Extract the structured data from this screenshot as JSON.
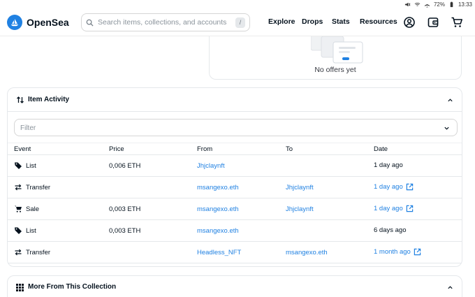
{
  "status_bar": {
    "battery": "72%",
    "time": "13:33"
  },
  "header": {
    "brand": "OpenSea",
    "search": {
      "placeholder": "Search items, collections, and accounts",
      "shortcut": "/"
    },
    "nav": [
      "Explore",
      "Drops",
      "Stats",
      "Resources"
    ],
    "icons": [
      "account-icon",
      "wallet-icon",
      "cart-icon"
    ]
  },
  "offers": {
    "empty_text": "No offers yet"
  },
  "activity": {
    "title": "Item Activity",
    "filter_placeholder": "Filter",
    "columns": [
      "Event",
      "Price",
      "From",
      "To",
      "Date"
    ],
    "rows": [
      {
        "event": "List",
        "icon": "tag-icon",
        "price": "0,006 ETH",
        "from": "Jhjclaynft",
        "to": "",
        "date": "1 day ago",
        "date_link": false
      },
      {
        "event": "Transfer",
        "icon": "transfer-icon",
        "price": "",
        "from": "msangexo.eth",
        "to": "Jhjclaynft",
        "date": "1 day ago",
        "date_link": true
      },
      {
        "event": "Sale",
        "icon": "cart-icon",
        "price": "0,003 ETH",
        "from": "msangexo.eth",
        "to": "Jhjclaynft",
        "date": "1 day ago",
        "date_link": true
      },
      {
        "event": "List",
        "icon": "tag-icon",
        "price": "0,003 ETH",
        "from": "msangexo.eth",
        "to": "",
        "date": "6 days ago",
        "date_link": false
      },
      {
        "event": "Transfer",
        "icon": "transfer-icon",
        "price": "",
        "from": "Headless_NFT",
        "to": "msangexo.eth",
        "date": "1 month ago",
        "date_link": true
      }
    ]
  },
  "collection": {
    "title": "More From This Collection"
  },
  "colors": {
    "accent": "#2081e2",
    "text": "#04111d",
    "border": "#e5e8eb"
  }
}
